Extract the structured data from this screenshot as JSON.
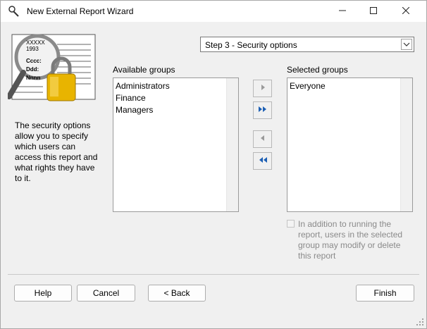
{
  "window": {
    "title": "New External Report Wizard",
    "icon": "wizard-wand-icon"
  },
  "titlebar_buttons": {
    "minimize_icon": "minimize-icon",
    "maximize_icon": "maximize-icon",
    "close_icon": "close-icon"
  },
  "step_select": {
    "value": "Step 3 - Security options",
    "arrow_icon": "chevron-down-icon"
  },
  "illustration": {
    "icon": "report-magnifier-lock-icon",
    "doc_lines": [
      "XXXXX",
      "1993",
      "Cccc:",
      "Ddd:",
      "Nnnn"
    ]
  },
  "description": "The security options allow you to specify which users can access this report and what rights they have to it.",
  "available_groups": {
    "label": "Available groups",
    "items": [
      "Administrators",
      "Finance",
      "Managers"
    ]
  },
  "selected_groups": {
    "label": "Selected groups",
    "items": [
      "Everyone"
    ]
  },
  "move_buttons": {
    "add_icon": "arrow-right-icon",
    "add_all_icon": "double-arrow-right-icon",
    "remove_icon": "arrow-left-icon",
    "remove_all_icon": "double-arrow-left-icon"
  },
  "modify_option": {
    "text": "In addition to running the report, users in the selected group may modify or delete this report",
    "checked": false,
    "enabled": false
  },
  "footer": {
    "help": "Help",
    "cancel": "Cancel",
    "back": "< Back",
    "finish": "Finish"
  },
  "colors": {
    "accent_blue": "#1c5fb4",
    "disabled_gray": "#8a8a8a",
    "lock_gold": "#e8b400"
  }
}
